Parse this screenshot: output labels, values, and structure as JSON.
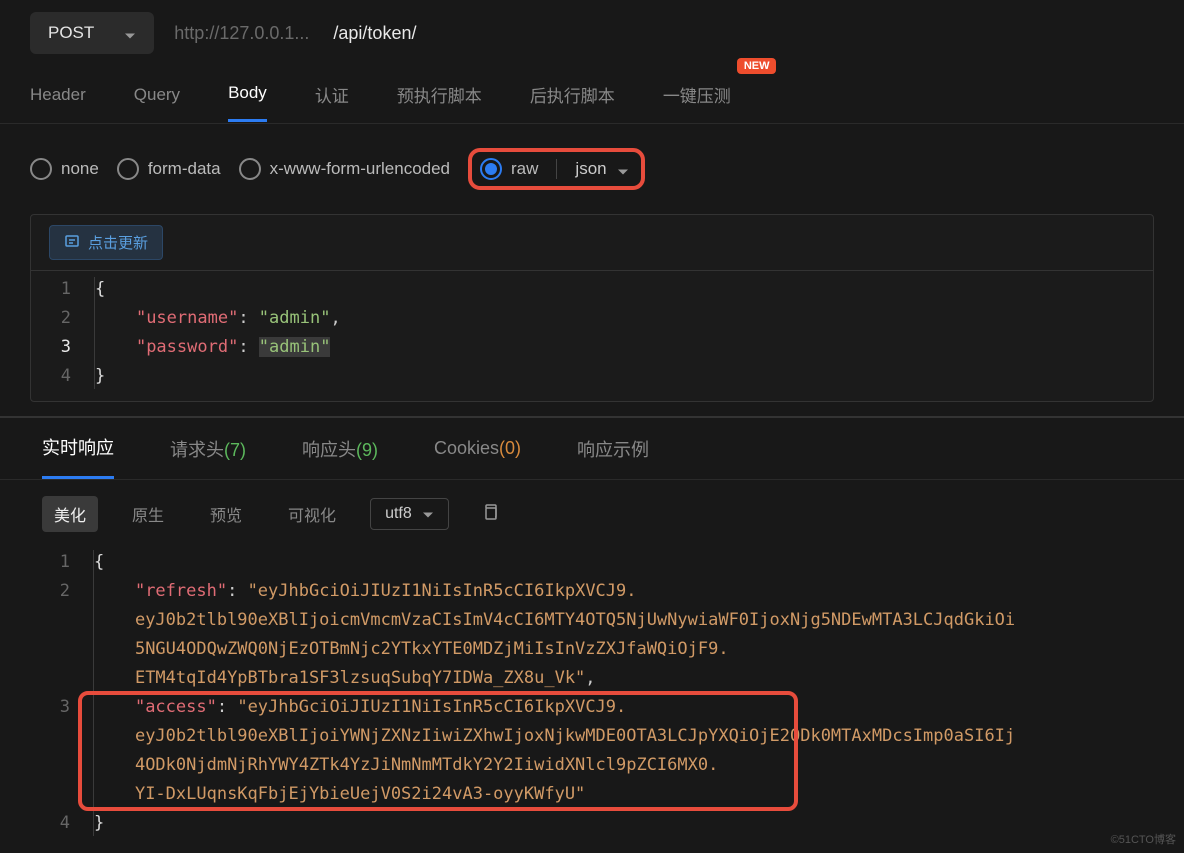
{
  "request": {
    "method": "POST",
    "url_host": "http://127.0.0.1...",
    "url_path": "/api/token/"
  },
  "tabs": {
    "items": [
      "Header",
      "Query",
      "Body",
      "认证",
      "预执行脚本",
      "后执行脚本",
      "一键压测"
    ],
    "new_badge": "NEW"
  },
  "body_types": {
    "none": "none",
    "form_data": "form-data",
    "url_encoded": "x-www-form-urlencoded",
    "raw": "raw",
    "format": "json"
  },
  "editor": {
    "refresh_label": "点击更新",
    "lines": [
      "1",
      "2",
      "3",
      "4"
    ],
    "json": {
      "username_key": "\"username\"",
      "username_val": "\"admin\"",
      "password_key": "\"password\"",
      "password_val": "\"admin\""
    }
  },
  "response_tabs": {
    "realtime": "实时响应",
    "req_head": "请求头",
    "req_head_count": "(7)",
    "res_head": "响应头",
    "res_head_count": "(9)",
    "cookies": "Cookies",
    "cookies_count": "(0)",
    "example": "响应示例"
  },
  "view": {
    "beautify": "美化",
    "raw": "原生",
    "preview": "预览",
    "visual": "可视化",
    "encoding": "utf8"
  },
  "response_body": {
    "lines": [
      "1",
      "2",
      "",
      "",
      "",
      "3",
      "",
      "",
      "",
      "4"
    ],
    "refresh_key": "\"refresh\"",
    "refresh_val_l1": "\"eyJhbGciOiJIUzI1NiIsInR5cCI6IkpXVCJ9.",
    "refresh_val_l2": "eyJ0b2tlbl90eXBlIjoicmVmcmVzaCIsImV4cCI6MTY4OTQ5NjUwNywiaWF0IjoxNjg5NDEwMTA3LCJqdGkiOi",
    "refresh_val_l3": "5NGU4ODQwZWQ0NjEzOTBmNjc2YTkxYTE0MDZjMiIsInVzZXJfaWQiOjF9.",
    "refresh_val_l4": "ETM4tqId4YpBTbra1SF3lzsuqSubqY7IDWa_ZX8u_Vk\"",
    "access_key": "\"access\"",
    "access_val_l1": "\"eyJhbGciOiJIUzI1NiIsInR5cCI6IkpXVCJ9.",
    "access_val_l2": "eyJ0b2tlbl90eXBlIjoiYWNjZXNzIiwiZXhwIjoxNjkwMDE0OTA3LCJpYXQiOjE2ODk0MTAxMDcsImp0aSI6Ij",
    "access_val_l3": "4ODk0NjdmNjRhYWY4ZTk4YzJiNmNmMTdkY2Y2IiwidXNlcl9pZCI6MX0.",
    "access_val_l4": "YI-DxLUqnsKqFbjEjYbieUejV0S2i24vA3-oyyKWfyU\""
  },
  "watermark": "©51CTO博客"
}
